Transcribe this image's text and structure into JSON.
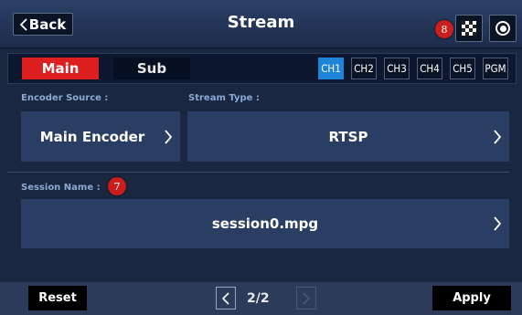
{
  "header": {
    "back_label": "Back",
    "title": "Stream",
    "badge_record_count": "8"
  },
  "tabs": {
    "main_label": "Main",
    "sub_label": "Sub",
    "channels": [
      "CH1",
      "CH2",
      "CH3",
      "CH4",
      "CH5",
      "PGM"
    ],
    "active_channel": "CH1"
  },
  "form": {
    "encoder_source_label": "Encoder Source :",
    "encoder_source_value": "Main Encoder",
    "stream_type_label": "Stream Type :",
    "stream_type_value": "RTSP",
    "session_name_label": "Session Name :",
    "session_name_badge": "7",
    "session_name_value": "session0.mpg"
  },
  "footer": {
    "reset_label": "Reset",
    "page_indicator": "2/2",
    "apply_label": "Apply"
  },
  "colors": {
    "accent_red": "#dd1f1f",
    "active_channel": "#1e84d8",
    "panel": "#2a3e63",
    "background": "#1a2740"
  }
}
